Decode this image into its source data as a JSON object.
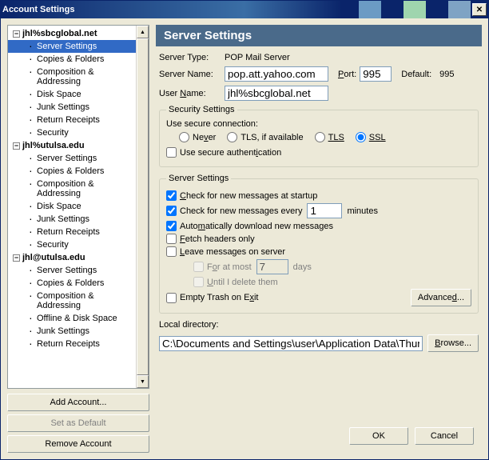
{
  "title": "Account Settings",
  "tree": {
    "accounts": [
      {
        "name": "jhl%sbcglobal.net",
        "items": [
          "Server Settings",
          "Copies & Folders",
          "Composition & Addressing",
          "Disk Space",
          "Junk Settings",
          "Return Receipts",
          "Security"
        ],
        "selected": 0
      },
      {
        "name": "jhl%utulsa.edu",
        "items": [
          "Server Settings",
          "Copies & Folders",
          "Composition & Addressing",
          "Disk Space",
          "Junk Settings",
          "Return Receipts",
          "Security"
        ],
        "selected": -1
      },
      {
        "name": "jhl@utulsa.edu",
        "items": [
          "Server Settings",
          "Copies & Folders",
          "Composition & Addressing",
          "Offline & Disk Space",
          "Junk Settings",
          "Return Receipts"
        ],
        "selected": -1
      }
    ]
  },
  "buttons": {
    "add": "Add Account...",
    "default": "Set as Default",
    "remove": "Remove Account",
    "ok": "OK",
    "cancel": "Cancel",
    "advanced": "Advanced...",
    "browse": "Browse..."
  },
  "header": "Server Settings",
  "server": {
    "type_label": "Server Type:",
    "type_value": "POP Mail Server",
    "name_label": "Server Name:",
    "name_value": "pop.att.yahoo.com",
    "port_label": "Port:",
    "port_value": "995",
    "default_label": "Default:",
    "default_value": "995",
    "user_label": "User Name:",
    "user_value": "jhl%sbcglobal.net"
  },
  "security": {
    "legend": "Security Settings",
    "use_label": "Use secure connection:",
    "never": "Never",
    "tls_avail": "TLS, if available",
    "tls": "TLS",
    "ssl": "SSL",
    "auth": "Use secure authentication"
  },
  "settings": {
    "legend": "Server Settings",
    "startup": "Check for new messages at startup",
    "every_pre": "Check for new messages every",
    "every_val": "1",
    "every_post": "minutes",
    "auto": "Automatically download new messages",
    "fetch": "Fetch headers only",
    "leave": "Leave messages on server",
    "atmost_pre": "For at most",
    "atmost_val": "7",
    "atmost_post": "days",
    "until": "Until I delete them",
    "empty": "Empty Trash on Exit"
  },
  "dir": {
    "label": "Local directory:",
    "value": "C:\\Documents and Settings\\user\\Application Data\\Thunderbird\\"
  }
}
